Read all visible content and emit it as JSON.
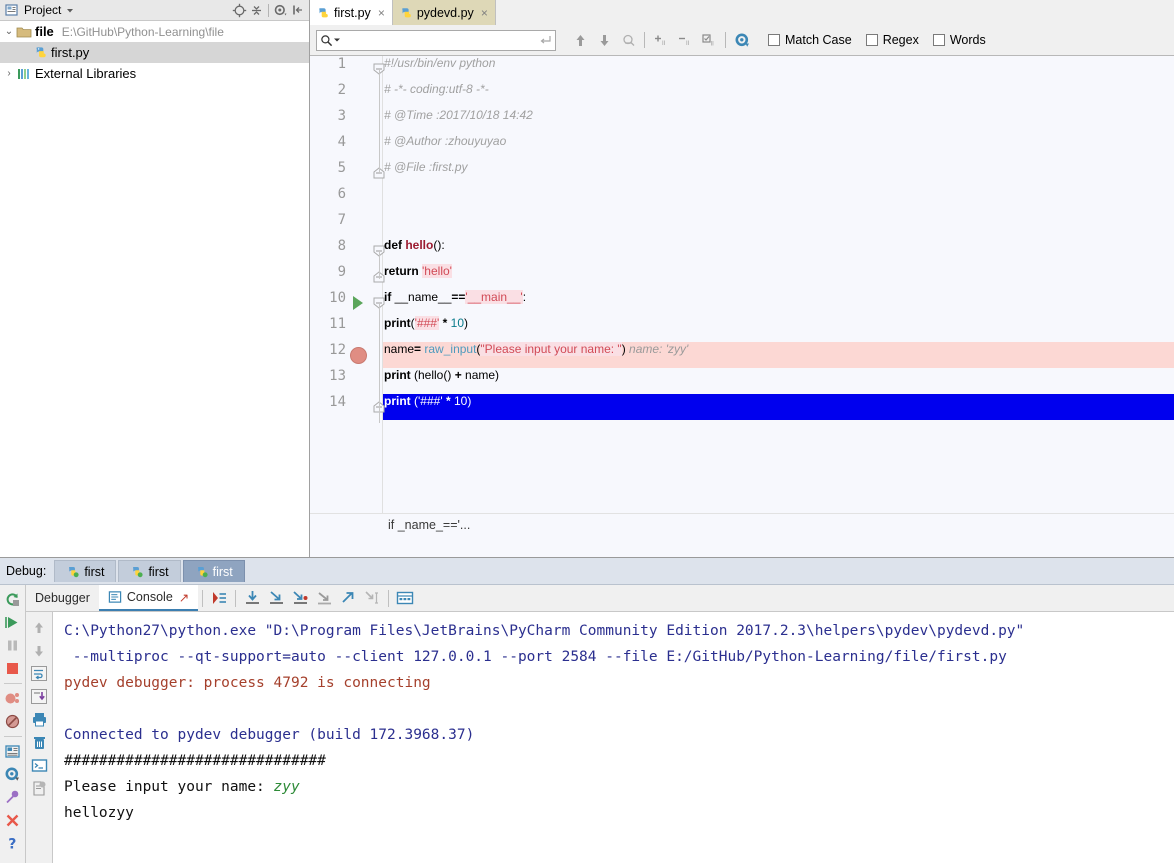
{
  "project": {
    "header_title": "Project",
    "icons": [
      "project-view-icon",
      "collapse-all-icon",
      "locate-icon",
      "settings-gear-icon",
      "hide-panel-icon"
    ],
    "tree": [
      {
        "label": "file",
        "path": "E:\\GitHub\\Python-Learning\\file",
        "arrow": "⌄",
        "icon": "folder-icon",
        "bold": true,
        "selected": false,
        "indent": 0
      },
      {
        "label": "first.py",
        "path": "",
        "arrow": "",
        "icon": "python-file-icon",
        "bold": false,
        "selected": true,
        "indent": 1
      },
      {
        "label": "External Libraries",
        "path": "",
        "arrow": "›",
        "icon": "libraries-icon",
        "bold": false,
        "selected": false,
        "indent": 0
      }
    ]
  },
  "editor": {
    "tabs": [
      {
        "label": "first.py",
        "state": "active",
        "close": "×",
        "icon": "python-file-icon"
      },
      {
        "label": "pydevd.py",
        "state": "highlight",
        "close": "×",
        "icon": "python-file-icon"
      }
    ],
    "find": {
      "placeholder": "",
      "value": "",
      "search_icon": "search-icon",
      "dropdown_icon": "chevron-down-icon",
      "enter_icon": "enter-return-icon",
      "buttons": [
        "find-previous-icon",
        "find-next-icon",
        "select-all-occurrences-icon",
        "add-occurrence-icon",
        "remove-occurrence-icon",
        "select-all-icon",
        "find-settings-gear-icon"
      ],
      "checkboxes": [
        {
          "label": "Match Case",
          "checked": false
        },
        {
          "label": "Regex",
          "checked": false
        },
        {
          "label": "Words",
          "checked": false
        }
      ]
    },
    "breadcrumb": "if _name_=='...",
    "lines": [
      {
        "n": "1",
        "tokens": [
          {
            "t": "comment",
            "s": "#!/usr/bin/env python"
          }
        ],
        "row": "normal",
        "gutter": "fold-open",
        "run_marker": false,
        "breakpoint": false
      },
      {
        "n": "2",
        "tokens": [
          {
            "t": "comment",
            "s": "# -*- coding:utf-8 -*-"
          }
        ],
        "row": "normal",
        "gutter": "",
        "run_marker": false,
        "breakpoint": false
      },
      {
        "n": "3",
        "tokens": [
          {
            "t": "comment",
            "s": "# @Time       :2017/10/18 14:42"
          }
        ],
        "row": "normal",
        "gutter": "",
        "run_marker": false,
        "breakpoint": false
      },
      {
        "n": "4",
        "tokens": [
          {
            "t": "comment",
            "s": "# @Author     :zhouyuyao"
          }
        ],
        "row": "normal",
        "gutter": "",
        "run_marker": false,
        "breakpoint": false
      },
      {
        "n": "5",
        "tokens": [
          {
            "t": "comment",
            "s": "# @File       :first.py"
          }
        ],
        "row": "normal",
        "gutter": "fold-close",
        "run_marker": false,
        "breakpoint": false
      },
      {
        "n": "6",
        "tokens": [],
        "row": "normal",
        "gutter": "",
        "run_marker": false,
        "breakpoint": false
      },
      {
        "n": "7",
        "tokens": [],
        "row": "normal",
        "gutter": "",
        "run_marker": false,
        "breakpoint": false
      },
      {
        "n": "8",
        "tokens": [
          {
            "t": "kw",
            "s": "def "
          },
          {
            "t": "fn",
            "s": "hello"
          },
          {
            "t": "plain",
            "s": "():"
          }
        ],
        "row": "normal",
        "gutter": "fold-open",
        "run_marker": false,
        "breakpoint": false
      },
      {
        "n": "9",
        "tokens": [
          {
            "t": "plain",
            "s": "    "
          },
          {
            "t": "kw",
            "s": "return "
          },
          {
            "t": "str",
            "s": "'hello'"
          }
        ],
        "row": "normal",
        "gutter": "fold-close",
        "run_marker": false,
        "breakpoint": false
      },
      {
        "n": "10",
        "tokens": [
          {
            "t": "kw",
            "s": "if "
          },
          {
            "t": "plain",
            "s": "__name__"
          },
          {
            "t": "kw",
            "s": "=="
          },
          {
            "t": "str",
            "s": "'__main__'"
          },
          {
            "t": "plain",
            "s": ":"
          }
        ],
        "row": "normal",
        "gutter": "fold-open",
        "run_marker": true,
        "breakpoint": false
      },
      {
        "n": "11",
        "tokens": [
          {
            "t": "plain",
            "s": "    "
          },
          {
            "t": "kw",
            "s": "print"
          },
          {
            "t": "plain",
            "s": "("
          },
          {
            "t": "str",
            "s": "'###'"
          },
          {
            "t": "plain",
            "s": " "
          },
          {
            "t": "kw",
            "s": "*"
          },
          {
            "t": "plain",
            "s": " "
          },
          {
            "t": "num",
            "s": "10"
          },
          {
            "t": "plain",
            "s": ")"
          }
        ],
        "row": "normal",
        "gutter": "",
        "run_marker": false,
        "breakpoint": false
      },
      {
        "n": "12",
        "tokens": [
          {
            "t": "plain",
            "s": "    name"
          },
          {
            "t": "kw",
            "s": "="
          },
          {
            "t": "plain",
            "s": " "
          },
          {
            "t": "builtin",
            "s": "raw_input"
          },
          {
            "t": "plain",
            "s": "("
          },
          {
            "t": "str",
            "s": "\"Please input your name: \""
          },
          {
            "t": "plain",
            "s": ")"
          },
          {
            "t": "hint",
            "s": "   name: 'zyy'"
          }
        ],
        "row": "breakpoint",
        "gutter": "",
        "run_marker": false,
        "breakpoint": true
      },
      {
        "n": "13",
        "tokens": [
          {
            "t": "plain",
            "s": "    "
          },
          {
            "t": "kw",
            "s": "print"
          },
          {
            "t": "plain",
            "s": " (hello() "
          },
          {
            "t": "kw",
            "s": "+"
          },
          {
            "t": "plain",
            "s": " name)"
          }
        ],
        "row": "normal",
        "gutter": "",
        "run_marker": false,
        "breakpoint": false
      },
      {
        "n": "14",
        "tokens": [
          {
            "t": "plain",
            "s": "    "
          },
          {
            "t": "kw",
            "s": "print"
          },
          {
            "t": "plain",
            "s": " ("
          },
          {
            "t": "str",
            "s": "'###'"
          },
          {
            "t": "plain",
            "s": " "
          },
          {
            "t": "kw",
            "s": "*"
          },
          {
            "t": "plain",
            "s": " "
          },
          {
            "t": "num",
            "s": "10"
          },
          {
            "t": "plain",
            "s": ")"
          }
        ],
        "row": "selected",
        "gutter": "fold-close",
        "run_marker": false,
        "breakpoint": false
      }
    ]
  },
  "debug": {
    "title": "Debug:",
    "tabs": [
      {
        "label": "first",
        "active": false
      },
      {
        "label": "first",
        "active": false
      },
      {
        "label": "first",
        "active": true
      }
    ],
    "sub_tabs": [
      {
        "label": "Debugger",
        "active": false,
        "icon": "debugger-icon"
      },
      {
        "label": "Console",
        "active": true,
        "icon": "console-icon"
      }
    ],
    "step_icons": [
      "show-execution-point-icon",
      "step-over-icon",
      "step-into-icon",
      "step-into-my-code-icon",
      "force-step-into-icon",
      "step-out-icon",
      "run-to-cursor-icon",
      "evaluate-expression-icon"
    ],
    "left_rail_icons": [
      "rerun-icon",
      "resume-program-icon",
      "pause-program-icon",
      "stop-icon",
      "view-breakpoints-icon",
      "mute-breakpoints-icon",
      "layout-settings-icon",
      "settings-gear-icon",
      "pin-tab-icon",
      "close-icon",
      "help-icon"
    ],
    "console_rail_icons": [
      "scroll-up-icon",
      "scroll-down-icon",
      "soft-wrap-icon",
      "scroll-to-end-icon",
      "print-icon",
      "clear-all-icon",
      "open-terminal-icon",
      "annotate-icon"
    ],
    "console_lines": [
      {
        "color": "blue",
        "text": "C:\\Python27\\python.exe \"D:\\Program Files\\JetBrains\\PyCharm Community Edition 2017.2.3\\helpers\\pydev\\pydevd.py\""
      },
      {
        "color": "blue",
        "text": " --multiproc --qt-support=auto --client 127.0.0.1 --port 2584 --file E:/GitHub/Python-Learning/file/first.py"
      },
      {
        "color": "red",
        "text": "pydev debugger: process 4792 is connecting"
      },
      {
        "color": "blank",
        "text": ""
      },
      {
        "color": "blue",
        "text": "Connected to pydev debugger (build 172.3968.37)"
      },
      {
        "color": "black",
        "text": "##############################"
      },
      {
        "color": "mixed",
        "text": "Please input your name: ",
        "input": "zyy"
      },
      {
        "color": "black",
        "text": "hellozyy"
      }
    ]
  },
  "colors": {
    "editor_bg": "#f7f8fd",
    "breakpoint_line": "#fcd8d4",
    "selection": "#0000ee",
    "string_bg": "#fadfe4",
    "accent_blue": "#3c7fb1"
  }
}
